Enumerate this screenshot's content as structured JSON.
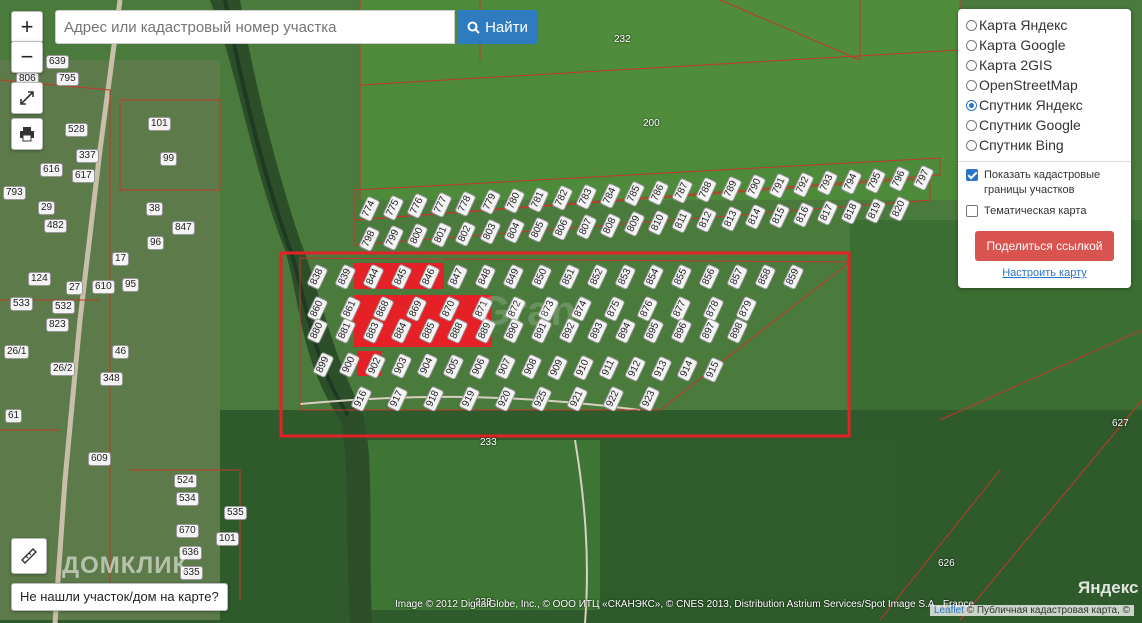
{
  "search": {
    "placeholder": "Адрес или кадастровый номер участка",
    "button_label": "Найти"
  },
  "zoom": {
    "in_label": "+",
    "out_label": "−"
  },
  "layers": {
    "options": [
      "Карта Яндекс",
      "Карта Google",
      "Карта 2GIS",
      "OpenStreetMap",
      "Спутник Яндекс",
      "Спутник Google",
      "Спутник Bing"
    ],
    "selected": "Спутник Яндекс"
  },
  "overlays": {
    "show_cadastre_label": "Показать кадастровые границы участков",
    "show_cadastre_checked": true,
    "thematic_label": "Тематическая карта",
    "thematic_checked": false
  },
  "share_label": "Поделиться ссылкой",
  "setup_map_label": "Настроить карту",
  "not_found_label": "Не нашли участок/дом на карте?",
  "attribution": "Image © 2012 DigitalGlobe, Inc., © ООО ИТЦ «СКАНЭКС», © CNES 2013, Distribution Astrium Services/Spot Image S.A., France",
  "leaflet_label": "Leaflet",
  "pkk_label": "© Публичная кадастровая карта, ©",
  "yandex_logo": "Яндекс",
  "domclick_logo": "ДОМКЛИК",
  "colors": {
    "accent": "#2f7bbf",
    "share": "#d9534f",
    "highlight": "#e52127",
    "parcel_line": "#c0392b"
  },
  "map_labels": {
    "top": [
      "232",
      "200",
      "233",
      "627",
      "626",
      "233"
    ],
    "row1": [
      "774",
      "775",
      "776",
      "777",
      "778",
      "779",
      "780",
      "781",
      "782",
      "783",
      "784",
      "785",
      "786",
      "787",
      "788",
      "789",
      "790",
      "791",
      "792",
      "793",
      "794",
      "795",
      "796",
      "797"
    ],
    "row2": [
      "798",
      "799",
      "800",
      "801",
      "802",
      "803",
      "804",
      "805",
      "806",
      "807",
      "808",
      "809",
      "810",
      "811",
      "812",
      "813",
      "814",
      "815",
      "816",
      "817",
      "818",
      "819",
      "820"
    ],
    "block_a": [
      "838",
      "839",
      "844",
      "845",
      "846",
      "847",
      "848",
      "849",
      "850",
      "851",
      "852",
      "853",
      "854",
      "855",
      "856",
      "857",
      "858",
      "859"
    ],
    "block_b": [
      "860",
      "861",
      "868",
      "869",
      "870",
      "871",
      "872",
      "873",
      "874",
      "875",
      "876",
      "877",
      "878",
      "879"
    ],
    "block_c": [
      "880",
      "881",
      "883",
      "884",
      "885",
      "888",
      "889",
      "890",
      "891",
      "892",
      "893",
      "894",
      "895",
      "896",
      "897",
      "898"
    ],
    "block_d": [
      "899",
      "900",
      "902",
      "903",
      "904",
      "905",
      "906",
      "907",
      "908",
      "909",
      "910",
      "911",
      "912",
      "913",
      "914",
      "915"
    ],
    "block_e": [
      "916",
      "917",
      "918",
      "919",
      "920",
      "925",
      "921",
      "922",
      "923"
    ],
    "village": [
      "806",
      "795",
      "639",
      "528",
      "101",
      "337",
      "99",
      "616",
      "617",
      "793",
      "29",
      "38",
      "847",
      "482",
      "96",
      "17",
      "610",
      "124",
      "27",
      "95",
      "533",
      "532",
      "823",
      "26/1",
      "46",
      "26/2",
      "348",
      "61",
      "609",
      "524",
      "534",
      "670",
      "535",
      "101",
      "636",
      "635"
    ]
  }
}
